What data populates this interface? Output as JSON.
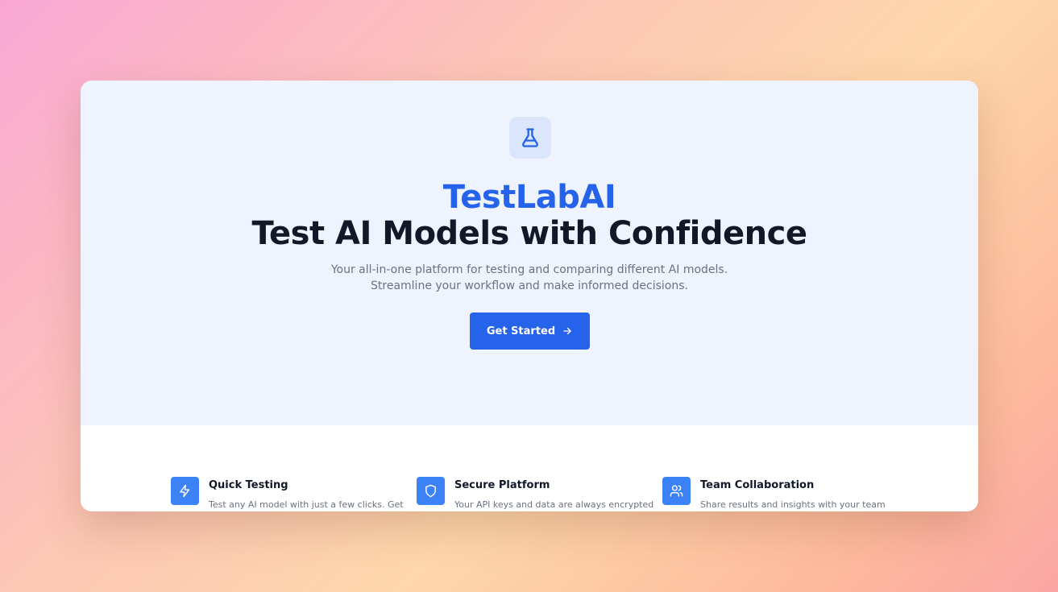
{
  "brand": {
    "name": "TestLabAI",
    "logo_icon": "flask-icon"
  },
  "hero": {
    "headline": "Test AI Models with Confidence",
    "subtitle": "Your all-in-one platform for testing and comparing different AI models. Streamline your workflow and make informed decisions.",
    "cta_label": "Get Started",
    "cta_icon": "arrow-right-icon"
  },
  "features": [
    {
      "icon": "lightning-icon",
      "title": "Quick Testing",
      "description": "Test any AI model with just a few clicks. Get"
    },
    {
      "icon": "shield-icon",
      "title": "Secure Platform",
      "description": "Your API keys and data are always encrypted"
    },
    {
      "icon": "users-icon",
      "title": "Team Collaboration",
      "description": "Share results and insights with your team"
    }
  ],
  "colors": {
    "accent": "#2563eb",
    "hero_background": "#eef3fe",
    "heading": "#111827",
    "muted_text": "#6b7280",
    "feature_icon_bg": "#3b82f6"
  }
}
